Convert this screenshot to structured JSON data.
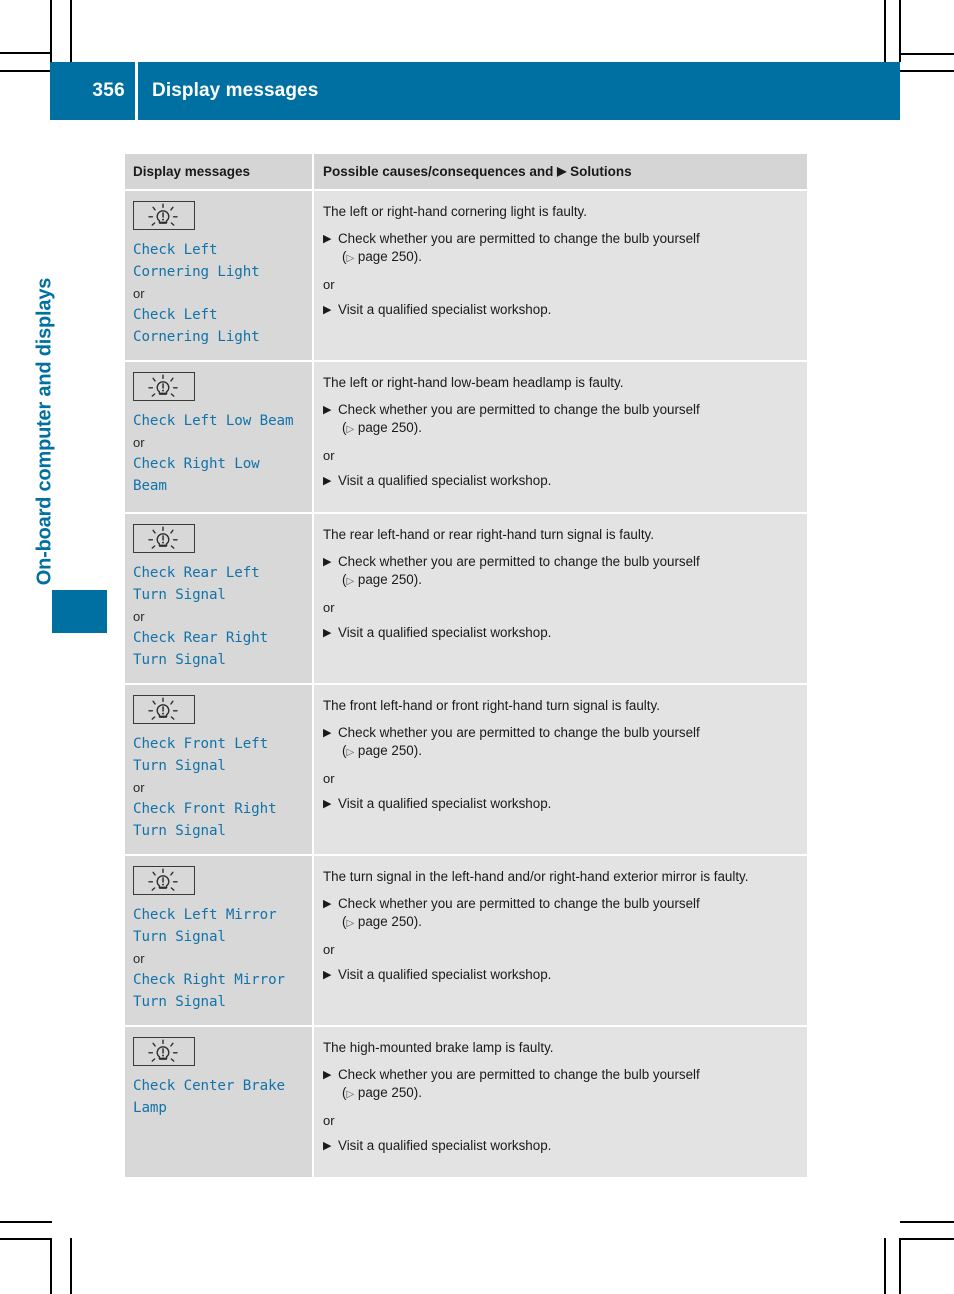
{
  "header": {
    "page_number": "356",
    "title": "Display messages",
    "accent_color": "#0070a3"
  },
  "chapter_tab": {
    "label": "On-board computer and displays"
  },
  "table": {
    "columns": {
      "left": "Display messages",
      "right_prefix": "Possible causes/consequences and",
      "right_triangle": "▶",
      "right_suffix": "Solutions"
    },
    "rows": [
      {
        "icon": "bulb-warning-icon",
        "messages": [
          {
            "type": "msg",
            "text": "Check Left\nCornering Light"
          },
          {
            "type": "or",
            "text": "or"
          },
          {
            "type": "msg",
            "text": "Check Left\nCornering Light"
          }
        ],
        "cause": "The left or right-hand cornering light is faulty.",
        "solution_1": "Check whether you are permitted to change the bulb yourself",
        "reference": "page 250",
        "or_text": "or",
        "solution_2": "Visit a qualified specialist workshop."
      },
      {
        "icon": "bulb-warning-icon",
        "messages": [
          {
            "type": "msg",
            "text": "Check Left Low Beam"
          },
          {
            "type": "or",
            "text": "or"
          },
          {
            "type": "msg",
            "text": "Check Right Low\nBeam"
          }
        ],
        "cause": "The left or right-hand low-beam headlamp is faulty.",
        "solution_1": "Check whether you are permitted to change the bulb yourself",
        "reference": "page 250",
        "or_text": "or",
        "solution_2": "Visit a qualified specialist workshop."
      },
      {
        "icon": "bulb-warning-icon",
        "messages": [
          {
            "type": "msg",
            "text": "Check Rear Left\nTurn Signal"
          },
          {
            "type": "or",
            "text": "or"
          },
          {
            "type": "msg",
            "text": "Check Rear Right\nTurn Signal"
          }
        ],
        "cause": "The rear left-hand or rear right-hand turn signal is faulty.",
        "solution_1": "Check whether you are permitted to change the bulb yourself",
        "reference": "page 250",
        "or_text": "or",
        "solution_2": "Visit a qualified specialist workshop."
      },
      {
        "icon": "bulb-warning-icon",
        "messages": [
          {
            "type": "msg",
            "text": "Check Front Left\nTurn Signal"
          },
          {
            "type": "or",
            "text": "or"
          },
          {
            "type": "msg",
            "text": "Check Front Right\nTurn Signal"
          }
        ],
        "cause": "The front left-hand or front right-hand turn signal is faulty.",
        "solution_1": "Check whether you are permitted to change the bulb yourself",
        "reference": "page 250",
        "or_text": "or",
        "solution_2": "Visit a qualified specialist workshop."
      },
      {
        "icon": "bulb-warning-icon",
        "messages": [
          {
            "type": "msg",
            "text": "Check Left Mirror\nTurn Signal"
          },
          {
            "type": "or",
            "text": "or"
          },
          {
            "type": "msg",
            "text": "Check Right Mirror\nTurn Signal"
          }
        ],
        "cause": "The turn signal in the left-hand and/or right-hand exterior mirror is faulty.",
        "solution_1": "Check whether you are permitted to change the bulb yourself",
        "reference": "page 250",
        "or_text": "or",
        "solution_2": "Visit a qualified specialist workshop."
      },
      {
        "icon": "bulb-warning-icon",
        "messages": [
          {
            "type": "msg",
            "text": "Check Center Brake\nLamp"
          }
        ],
        "cause": "The high-mounted brake lamp is faulty.",
        "solution_1": "Check whether you are permitted to change the bulb yourself",
        "reference": "page 250",
        "or_text": "or",
        "solution_2": "Visit a qualified specialist workshop."
      }
    ]
  }
}
